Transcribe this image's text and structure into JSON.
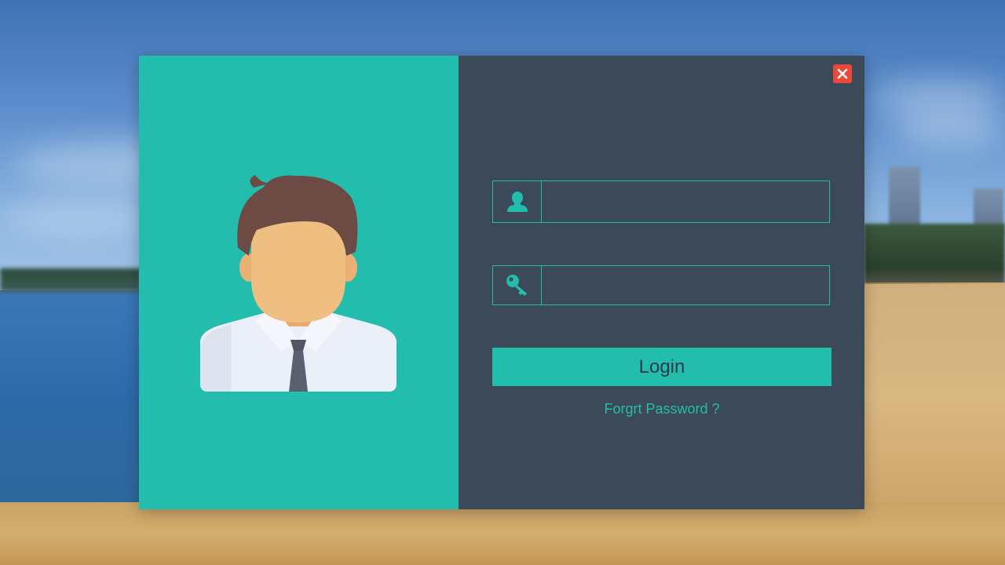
{
  "login_form": {
    "username": {
      "icon": "user-icon",
      "value": "",
      "placeholder": ""
    },
    "password": {
      "icon": "key-icon",
      "value": "",
      "placeholder": ""
    },
    "login_label": "Login",
    "forgot_label": "Forgrt Password ?",
    "close_icon": "close-icon"
  },
  "colors": {
    "accent": "#22bdad",
    "panel_dark": "#3c4958",
    "close": "#e8493b",
    "button_text": "#2e3b48"
  }
}
